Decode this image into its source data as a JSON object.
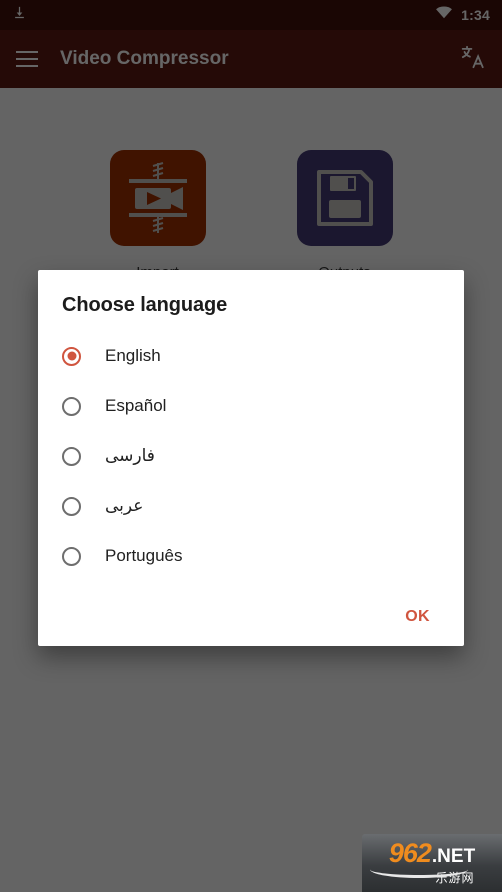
{
  "status_bar": {
    "download_icon": "download-icon",
    "wifi_icon": "wifi-icon",
    "clock": "1:34"
  },
  "app_bar": {
    "menu_icon": "hamburger-menu-icon",
    "title": "Video Compressor",
    "translate_icon": "translate-icon"
  },
  "home": {
    "tiles": [
      {
        "label": "Import",
        "icon": "video-compress-icon",
        "color": "#a03000"
      },
      {
        "label": "Outputs",
        "icon": "floppy-save-icon",
        "color": "#453a77"
      }
    ]
  },
  "dialog": {
    "title": "Choose language",
    "selected_index": 0,
    "options": [
      {
        "label": "English",
        "rtl": false,
        "selected": true
      },
      {
        "label": "Español",
        "rtl": false,
        "selected": false
      },
      {
        "label": "فارسی",
        "rtl": true,
        "selected": false
      },
      {
        "label": "عربی",
        "rtl": true,
        "selected": false
      },
      {
        "label": "Português",
        "rtl": false,
        "selected": false
      }
    ],
    "ok_label": "OK",
    "accent_color": "#d0553f"
  },
  "watermark": {
    "number": "962",
    "domain": ".NET",
    "chinese": "乐游网"
  },
  "colors": {
    "app_bar": "#5d1a12",
    "status_bar": "#43110c",
    "scrim": "rgba(0,0,0,0.60)",
    "accent": "#d0553f",
    "dialog_bg": "#ffffff"
  }
}
